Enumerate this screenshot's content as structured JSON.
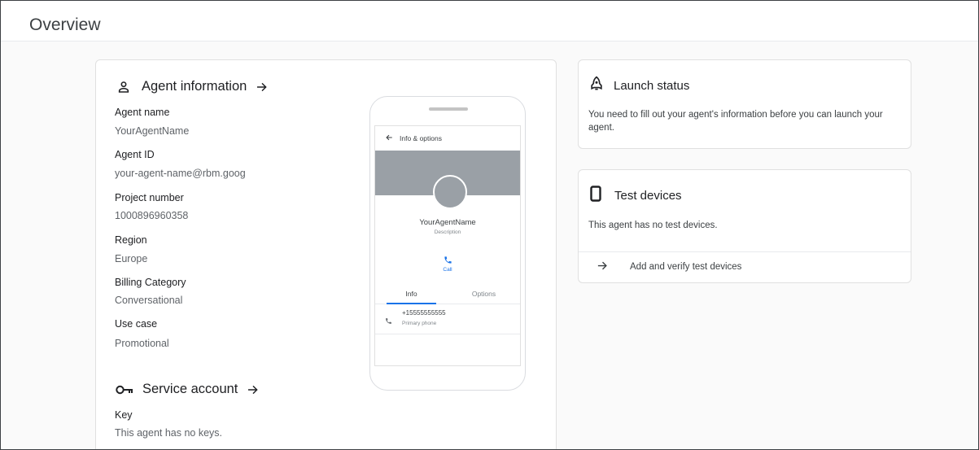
{
  "page": {
    "title": "Overview"
  },
  "agent_info": {
    "heading": "Agent information",
    "fields": [
      {
        "label": "Agent name",
        "value": "YourAgentName"
      },
      {
        "label": "Agent ID",
        "value": "your-agent-name@rbm.goog"
      },
      {
        "label": "Project number",
        "value": "1000896960358"
      },
      {
        "label": "Region",
        "value": "Europe"
      },
      {
        "label": "Billing Category",
        "value": "Conversational"
      },
      {
        "label": "Use case",
        "value": "Promotional"
      }
    ]
  },
  "service_account": {
    "heading": "Service account",
    "key_label": "Key",
    "key_value": "This agent has no keys."
  },
  "phone_preview": {
    "header": "Info & options",
    "agent_name": "YourAgentName",
    "description": "Description",
    "call_label": "Call",
    "tabs": [
      "Info",
      "Options"
    ],
    "phone_number": "+15555555555",
    "phone_type": "Primary phone",
    "colors": {
      "hero": "#9aa0a6",
      "accent": "#1a73e8"
    }
  },
  "launch_status": {
    "heading": "Launch status",
    "message": "You need to fill out your agent's information before you can launch your agent."
  },
  "test_devices": {
    "heading": "Test devices",
    "message": "This agent has no test devices.",
    "action": "Add and verify test devices"
  },
  "icons": [
    "person-icon",
    "arrow-right-icon",
    "key-icon",
    "arrow-left-icon",
    "phone-icon",
    "rocket-icon",
    "smartphone-icon"
  ]
}
